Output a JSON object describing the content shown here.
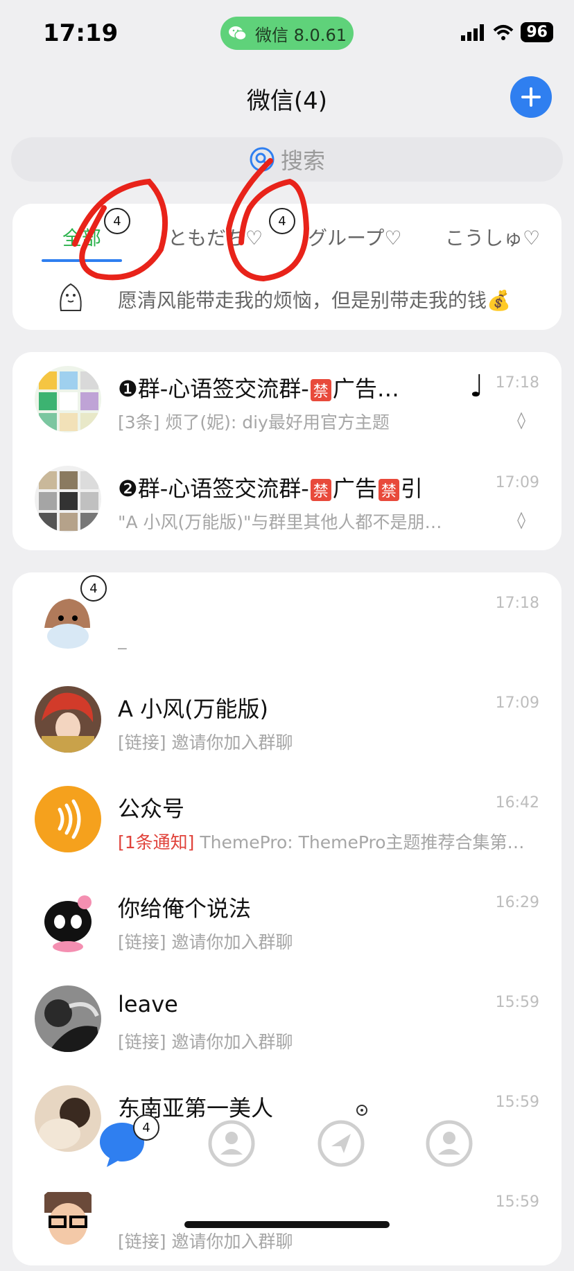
{
  "status_bar": {
    "time": "17:19",
    "app_pill": "微信 8.0.61",
    "battery": "96"
  },
  "header": {
    "title": "微信(4)"
  },
  "search": {
    "placeholder": "搜索"
  },
  "tabs": [
    {
      "label": "全部",
      "badge": "4",
      "active": true
    },
    {
      "label": "ともだち♡",
      "badge": "4",
      "active": false
    },
    {
      "label": "グループ♡",
      "active": false
    },
    {
      "label": "こうしゅ♡",
      "active": false
    }
  ],
  "motto": "愿清风能带走我的烦恼，但是别带走我的钱💰",
  "pinned_chats": [
    {
      "name_prefix": "❶群-心语签交流群-",
      "ban1": "禁",
      "name_suffix": "广告…",
      "preview": "[3条] 烦了(妮): diy最好用官方主题",
      "time": "17:18",
      "mute": "◊",
      "note": "♩"
    },
    {
      "name_prefix": "❷群-心语签交流群-",
      "ban1": "禁",
      "name_mid": "广告",
      "ban2": "禁",
      "name_suffix": "引",
      "preview": "\"A 小风(万能版)\"与群里其他人都不是朋…",
      "time": "17:09",
      "mute": "◊"
    }
  ],
  "chats": [
    {
      "name": "",
      "preview": "_",
      "time": "17:18",
      "badge": "4"
    },
    {
      "name": "A  小风(万能版)",
      "preview": "[链接] 邀请你加入群聊",
      "time": "17:09"
    },
    {
      "name": "公众号",
      "preview_alert": "[1条通知]",
      "preview": " ThemePro: ThemePro主题推荐合集第…",
      "time": "16:42"
    },
    {
      "name": "你给俺个说法",
      "preview": "[链接] 邀请你加入群聊",
      "time": "16:29"
    },
    {
      "name": "leave",
      "preview": "[链接] 邀请你加入群聊",
      "time": "15:59"
    },
    {
      "name": "东南亚第一美人",
      "preview": "",
      "time": "15:59"
    },
    {
      "name": "",
      "preview": "[链接] 邀请你加入群聊",
      "time": "15:59"
    }
  ],
  "tabbar": {
    "chats_badge": "4"
  },
  "colors": {
    "accent_blue": "#2f7ff0",
    "wechat_green": "#5fd27a",
    "annotation_red": "#e8231a"
  }
}
